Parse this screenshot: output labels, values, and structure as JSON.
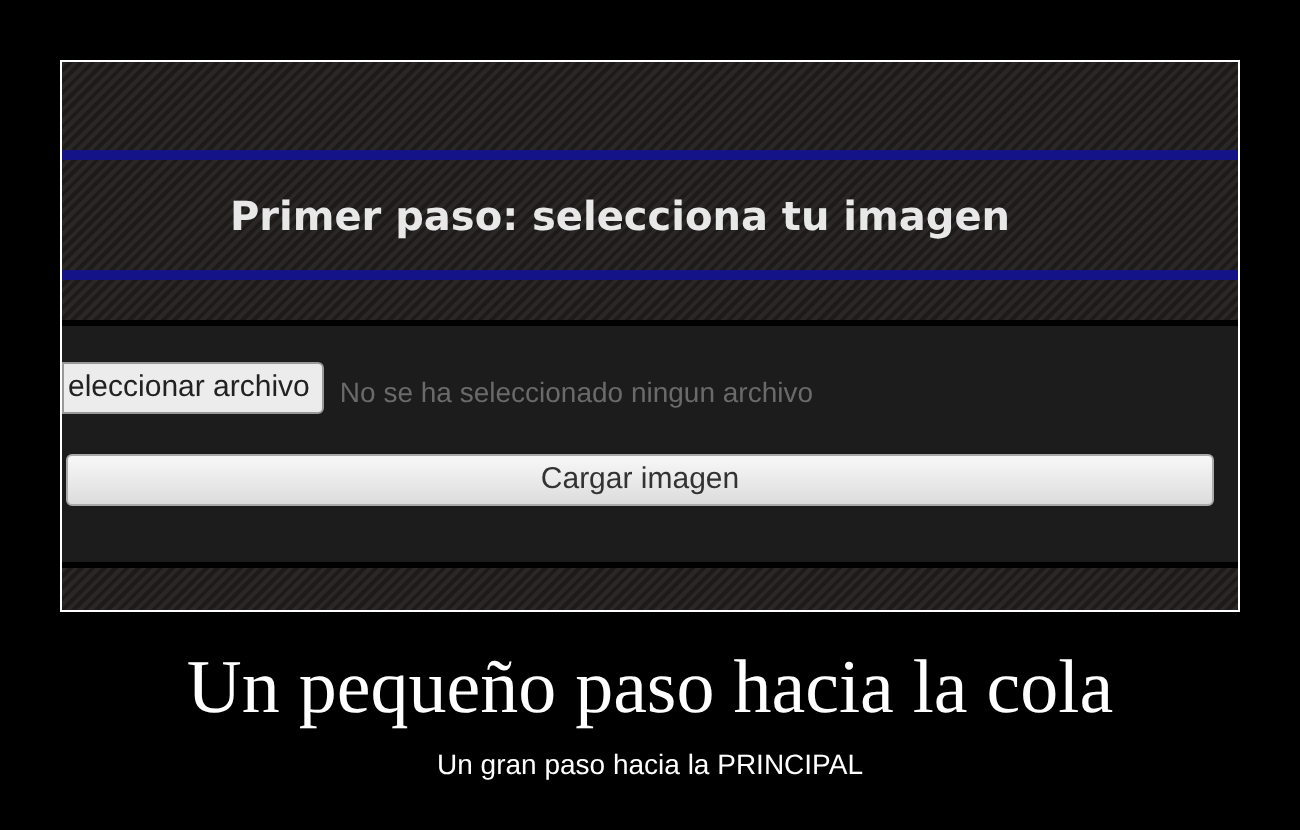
{
  "screenshot": {
    "heading": "Primer paso: selecciona tu imagen",
    "file_button": "eleccionar archivo",
    "file_status": "No se ha seleccionado ningun archivo",
    "upload_button": "Cargar imagen"
  },
  "caption": {
    "title": "Un pequeño paso hacia la cola",
    "subtitle": "Un gran paso hacia la PRINCIPAL"
  }
}
